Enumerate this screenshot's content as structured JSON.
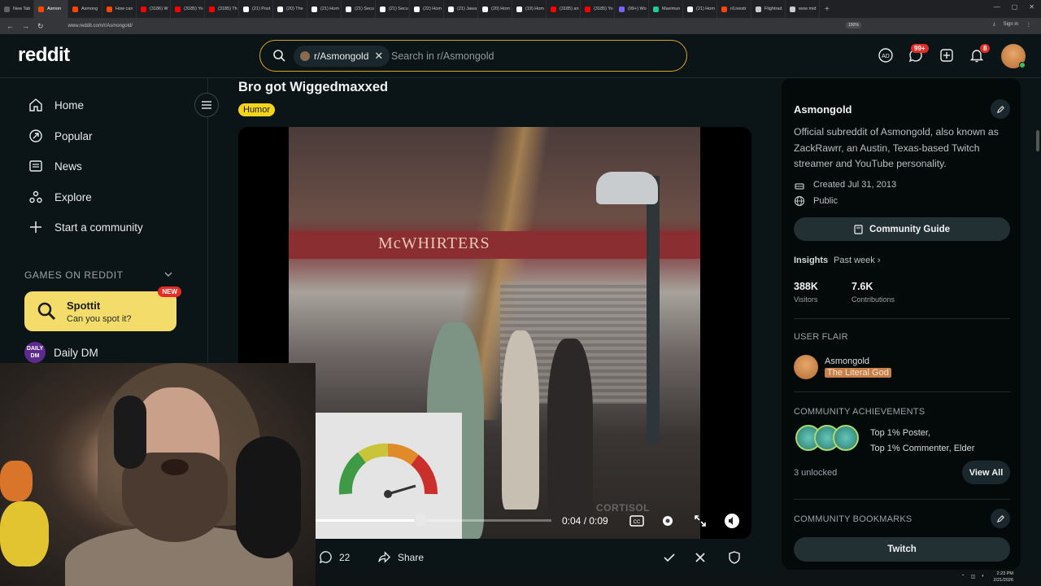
{
  "browser": {
    "tabs": [
      {
        "label": "New Tab",
        "color": "#5f6368"
      },
      {
        "label": "Asmon",
        "color": "#ff4500",
        "active": true
      },
      {
        "label": "Asmong",
        "color": "#ff4500"
      },
      {
        "label": "How can",
        "color": "#ff4500"
      },
      {
        "label": "(3186) W",
        "color": "#ff0000"
      },
      {
        "label": "(3185) Yo",
        "color": "#ff0000"
      },
      {
        "label": "(3185) Th",
        "color": "#ff0000"
      },
      {
        "label": "(21) Post",
        "color": "#ffffff"
      },
      {
        "label": "(20) The",
        "color": "#ffffff"
      },
      {
        "label": "(21) Hom",
        "color": "#ffffff"
      },
      {
        "label": "(21) Secu",
        "color": "#ffffff"
      },
      {
        "label": "(21) Secu",
        "color": "#ffffff"
      },
      {
        "label": "(22) Hom",
        "color": "#ffffff"
      },
      {
        "label": "(21) Jawa",
        "color": "#ffffff"
      },
      {
        "label": "(20) Hom",
        "color": "#ffffff"
      },
      {
        "label": "(19) Hom",
        "color": "#ffffff"
      },
      {
        "label": "(3185) an",
        "color": "#ff0000"
      },
      {
        "label": "(3185) Yo",
        "color": "#ff0000"
      },
      {
        "label": "(99+) Wo",
        "color": "#7b61ff"
      },
      {
        "label": "Maximun",
        "color": "#20c997"
      },
      {
        "label": "(21) Hom",
        "color": "#ffffff"
      },
      {
        "label": "r/Livestr",
        "color": "#ff4500"
      },
      {
        "label": "Flightrad",
        "color": "#cccccc"
      },
      {
        "label": "wow mid",
        "color": "#cccccc"
      }
    ],
    "url": "www.reddit.com/r/Asmongold/",
    "zoom": "150%",
    "sign_in": "Sign in"
  },
  "header": {
    "logo": "reddit",
    "search_chip": "r/Asmongold",
    "search_placeholder": "Search in r/Asmongold",
    "chat_badge": "99+",
    "notif_badge": "8"
  },
  "sidebar": {
    "items": [
      {
        "label": "Home",
        "icon": "home-icon"
      },
      {
        "label": "Popular",
        "icon": "popular-icon"
      },
      {
        "label": "News",
        "icon": "news-icon"
      },
      {
        "label": "Explore",
        "icon": "explore-icon"
      },
      {
        "label": "Start a community",
        "icon": "plus-icon"
      }
    ],
    "games_header": "GAMES ON REDDIT",
    "spottit_title": "Spottit",
    "spottit_sub": "Can you spot it?",
    "spottit_badge": "NEW",
    "daily_label": "Daily DM",
    "daily_logo": "DAILY DM"
  },
  "post": {
    "title": "Bro got Wiggedmaxxed",
    "flair": "Humor",
    "video_sign": "McWHIRTERS",
    "overlay_label": "CORTISOL",
    "time": "0:04 / 0:09",
    "progress": 0.444,
    "comments_count": "22",
    "share_label": "Share"
  },
  "community": {
    "name": "Asmongold",
    "description": "Official subreddit of Asmongold, also known as ZackRawrr, an Austin, Texas-based Twitch streamer and YouTube personality.",
    "created": "Created Jul 31, 2013",
    "visibility": "Public",
    "guide_label": "Community Guide",
    "insights_label": "Insights",
    "insights_period": "Past week",
    "visitors_value": "388K",
    "visitors_label": "Visitors",
    "contributions_value": "7.6K",
    "contributions_label": "Contributions",
    "user_flair_header": "USER FLAIR",
    "flair_user": "Asmongold",
    "flair_tag": "The Literal God",
    "achievements_header": "COMMUNITY ACHIEVEMENTS",
    "achievements_line1": "Top 1% Poster,",
    "achievements_line2": "Top 1% Commenter, Elder",
    "unlocked": "3 unlocked",
    "view_all": "View All",
    "bookmarks_header": "COMMUNITY BOOKMARKS",
    "bookmark_twitch": "Twitch"
  },
  "taskbar": {
    "time": "2:23 PM",
    "date": "2/21/2026"
  },
  "colors": {
    "accent": "#d9a326",
    "flair_yellow": "#f5d41c",
    "spottit_yellow": "#f3dc6a",
    "badge_red": "#e52d27"
  }
}
